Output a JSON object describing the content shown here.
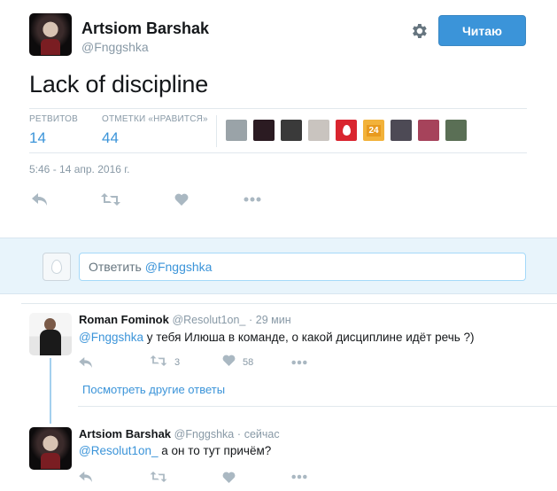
{
  "tweet": {
    "author_name": "Artsiom Barshak",
    "author_handle": "@Fnggshka",
    "follow_label": "Читаю",
    "text": "Lack of discipline",
    "retweets_label": "РЕТВИТОВ",
    "retweets_count": "14",
    "likes_label": "ОТМЕТКИ «НРАВИТСЯ»",
    "likes_count": "44",
    "timestamp": "5:46 - 14 апр. 2016 г.",
    "likers": [
      {
        "icon": "liker-avatar",
        "color": "#9aa3a8"
      },
      {
        "icon": "liker-avatar",
        "color": "#2b1b22"
      },
      {
        "icon": "liker-avatar",
        "color": "#3a3a3a"
      },
      {
        "icon": "liker-avatar",
        "color": "#c9c4bf"
      },
      {
        "icon": "liker-avatar",
        "color": "#d9252f"
      },
      {
        "icon": "liker-avatar",
        "color": "#f2b23a"
      },
      {
        "icon": "liker-avatar",
        "color": "#4d4a55"
      },
      {
        "icon": "liker-avatar",
        "color": "#a6435b"
      },
      {
        "icon": "liker-avatar",
        "color": "#5a6f55"
      }
    ],
    "liker_badge_text": "24"
  },
  "reply_bar": {
    "hint": "Ответить ",
    "mention": "@Fnggshka"
  },
  "replies": [
    {
      "name": "Roman Fominok",
      "handle": "@Resolut1on_",
      "dot": "·",
      "time": "29 мин",
      "mention": "@Fnggshka",
      "text": " у тебя Илюша в команде, о какой дисциплине идёт речь ?)",
      "retweets": "3",
      "likes": "58"
    },
    {
      "name": "Artsiom Barshak",
      "handle": "@Fnggshka",
      "dot": "·",
      "time": "сейчас",
      "mention": "@Resolut1on_",
      "text": " а он то тут причём?"
    }
  ],
  "more_replies": "Посмотреть другие ответы",
  "colors": {
    "accent": "#3b94d9",
    "muted": "#8899a6",
    "icon": "#aab8c2",
    "reply_bg": "#e8f4fb"
  }
}
